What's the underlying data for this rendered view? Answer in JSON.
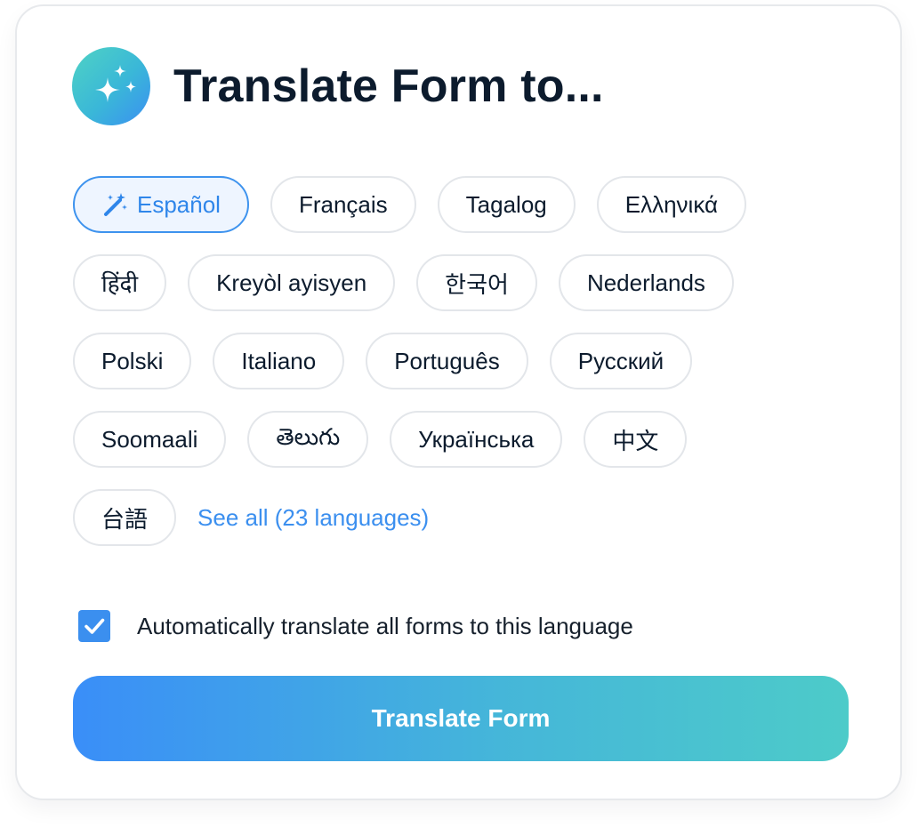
{
  "header": {
    "title": "Translate Form to...",
    "icon": "sparkles-icon"
  },
  "languages": {
    "selected": "Español",
    "rows": [
      [
        "Español",
        "Français",
        "Tagalog",
        "Ελληνικά"
      ],
      [
        "हिंदी",
        "Kreyòl ayisyen",
        "한국어",
        "Nederlands"
      ],
      [
        "Polski",
        "Italiano",
        "Português",
        "Русский"
      ],
      [
        "Soomaali",
        "తెలుగు",
        "Українська",
        "中文"
      ],
      [
        "台語"
      ]
    ],
    "see_all": "See all (23 languages)"
  },
  "auto_translate": {
    "checked": true,
    "label": "Automatically translate all forms to this language"
  },
  "actions": {
    "translate_label": "Translate Form"
  },
  "colors": {
    "accent": "#3b8fef",
    "gradient_start": "#3a8ef8",
    "gradient_end": "#4dcbc9",
    "title": "#0c1b2d",
    "chip_border": "#e3e6ea",
    "selected_bg": "#eef5ff"
  }
}
